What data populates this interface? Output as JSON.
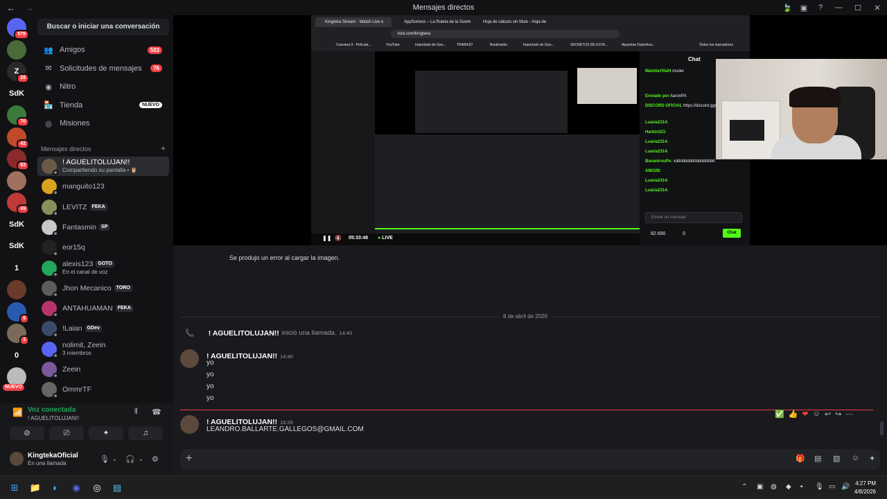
{
  "window": {
    "title": "Mensajes directos",
    "back": "←",
    "forward": "→"
  },
  "sidebar": {
    "search": "Buscar o iniciar una conversación",
    "nav": [
      {
        "label": "Amigos",
        "icon": "friends-icon",
        "glyph": "👥",
        "count": "503"
      },
      {
        "label": "Solicitudes de mensajes",
        "icon": "mail-icon",
        "glyph": "✉",
        "count": "76"
      },
      {
        "label": "Nitro",
        "icon": "nitro-icon",
        "glyph": "◉",
        "count": ""
      },
      {
        "label": "Tienda",
        "icon": "shop-icon",
        "glyph": "🏪",
        "badge": "NUEVO"
      },
      {
        "label": "Misiones",
        "icon": "quest-icon",
        "glyph": "◎",
        "count": ""
      }
    ],
    "dm_header": "Mensajes directos",
    "dm_add": "+",
    "dms": [
      {
        "name": "! AGUELITOLUJAN!!",
        "sub": "Compartiendo su pantalla • 🦉",
        "tag": "",
        "avatar": "#6b5a48"
      },
      {
        "name": "manguito123",
        "sub": "",
        "tag": "",
        "avatar": "#d9a21e"
      },
      {
        "name": "LEVITZ",
        "sub": "",
        "tag": "FEKA",
        "avatar": "#8a8f5c"
      },
      {
        "name": "Fantasmin",
        "sub": "",
        "tag": "SP",
        "avatar": "#c8c8c8"
      },
      {
        "name": "eor15q",
        "sub": "",
        "tag": "",
        "avatar": "#222"
      },
      {
        "name": "alexis123",
        "sub": "En el canal de voz",
        "tag": "GOTO",
        "avatar": "#23a55a"
      },
      {
        "name": "Jhon Mecanico",
        "sub": "",
        "tag": "TORO",
        "avatar": "#5c5c5c"
      },
      {
        "name": "ANTAHUAMAN",
        "sub": "",
        "tag": "FEKA",
        "avatar": "#b8336a"
      },
      {
        "name": "!Laian",
        "sub": "",
        "tag": "GDev",
        "avatar": "#3a4a6a"
      },
      {
        "name": "nolimit, Zeein",
        "sub": "3 miembros",
        "tag": "",
        "avatar": "#5865f2"
      },
      {
        "name": "Zeein",
        "sub": "",
        "tag": "",
        "avatar": "#7a5a9a"
      },
      {
        "name": "OmmrTF",
        "sub": "",
        "tag": "",
        "avatar": "#666"
      }
    ]
  },
  "servers": [
    {
      "label": "",
      "badge": "579",
      "color": "#5865f2"
    },
    {
      "label": "",
      "badge": "",
      "color": "#4a6a3a"
    },
    {
      "label": "Z",
      "badge": "28",
      "color": "#2a2a2a"
    },
    {
      "label": "SdK",
      "badge": "",
      "color": "#121214"
    },
    {
      "label": "",
      "badge": "70",
      "color": "#3a7a3a"
    },
    {
      "label": "",
      "badge": "42",
      "color": "#c04a2a"
    },
    {
      "label": "",
      "badge": "83",
      "color": "#8a2a2a"
    },
    {
      "label": "",
      "badge": "",
      "color": "#a07060"
    },
    {
      "label": "",
      "badge": "49",
      "color": "#c03a3a"
    },
    {
      "label": "SdK",
      "badge": "",
      "color": "#121214"
    },
    {
      "label": "SdK",
      "badge": "",
      "color": "#121214"
    },
    {
      "label": "1",
      "badge": "",
      "color": "#121214"
    },
    {
      "label": "",
      "badge": "",
      "color": "#6a3a2a"
    },
    {
      "label": "",
      "badge": "6",
      "color": "#2a5ab0"
    },
    {
      "label": "",
      "badge": "3",
      "color": "#7a6a5a"
    },
    {
      "label": "0",
      "badge": "",
      "color": "#121214"
    },
    {
      "label": "",
      "badge": "",
      "color": "#bbbbbb",
      "nuevo": "NUEVO"
    }
  ],
  "voice": {
    "status": "Voz conectada",
    "channel": "! AGUELITOLUJAN!!"
  },
  "user": {
    "name": "KingtekaOficial",
    "status": "En una llamada"
  },
  "stream": {
    "tabs": [
      "Kingteka Stream - Watch Live o",
      "AppSorteos – La Ruleta de la Suerte",
      "Hoja de cálculo sin título - Hoja de"
    ],
    "url": "kick.com/kingteka",
    "bookmarks": [
      "Cuevana 3 - Película...",
      "YouTube",
      "Importado de Goo...",
      "TRABAJO",
      "Bookmarks",
      "Importado de Goo...",
      "SECRETOS DE ESTA...",
      "Apuestas Deportiva...",
      "Todos los marcadores"
    ],
    "chat_title": "Chat",
    "chat_lines": [
      {
        "user": "MamitaYifaiH",
        "text": "moder"
      },
      {
        "user": "Enviado por",
        "text": "AaronPA"
      },
      {
        "user": "DISCORD OFICIAL",
        "text": "https://discord.gg/kingteka"
      },
      {
        "user": "Luaria2314:",
        "text": ""
      },
      {
        "user": "Harbin321:",
        "text": ""
      },
      {
        "user": "Luaria2314:",
        "text": ""
      },
      {
        "user": "Luaria2314:",
        "text": ""
      },
      {
        "user": "BananirouPe:",
        "text": "xddddddddddddddddd"
      },
      {
        "user": "AMO28:",
        "text": ""
      },
      {
        "user": "Luaria2314:",
        "text": ""
      },
      {
        "user": "Luaria2314:",
        "text": ""
      }
    ],
    "chat_placeholder": "Enviar un mensaje",
    "chat_button": "Chat",
    "viewers": "82.690",
    "points": "0",
    "time": "05:33:48",
    "live": "LIVE"
  },
  "chat": {
    "error": "Se produjo un error al cargar la imagen.",
    "date": "8 de abril de 2026",
    "call_user": "! AGUELITOLUJAN!!",
    "call_text": "inició una llamada.",
    "call_time": "14:40",
    "msg1": {
      "author": "! AGUELITOLUJAN!!",
      "time": "14:40",
      "lines": [
        "yo",
        "yo",
        "yo",
        "yo"
      ]
    },
    "msg2": {
      "author": "! AGUELITOLUJAN!!",
      "time": "16:26",
      "body": "LEANDRO.BALLARTE.GALLEGOS@GMAIL.COM"
    }
  },
  "taskbar": {
    "time": "4:27 PM",
    "date": "4/8/2026"
  }
}
